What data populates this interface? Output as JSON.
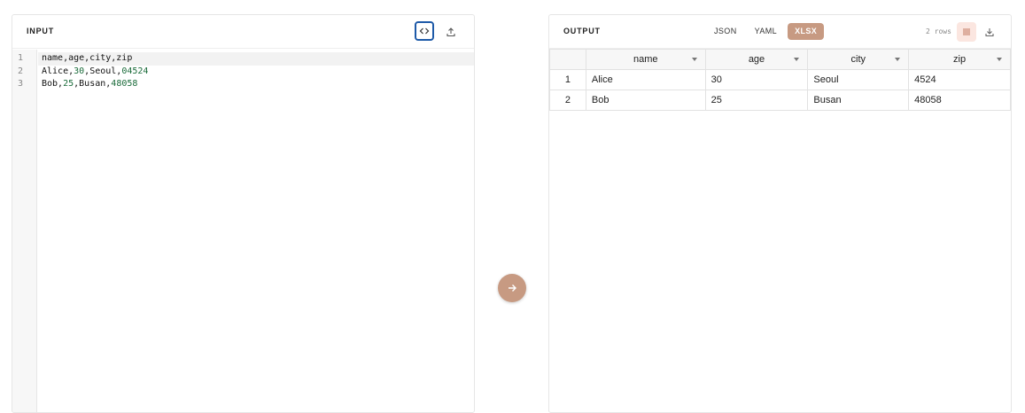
{
  "input": {
    "title": "INPUT",
    "line_numbers": [
      "1",
      "2",
      "3"
    ],
    "lines": [
      [
        {
          "t": "name,age,city,zip",
          "n": false
        }
      ],
      [
        {
          "t": "Alice,",
          "n": false
        },
        {
          "t": "30",
          "n": true
        },
        {
          "t": ",Seoul,",
          "n": false
        },
        {
          "t": "04524",
          "n": true
        }
      ],
      [
        {
          "t": "Bob,",
          "n": false
        },
        {
          "t": "25",
          "n": true
        },
        {
          "t": ",Busan,",
          "n": false
        },
        {
          "t": "48058",
          "n": true
        }
      ]
    ],
    "code_icon": "code-icon",
    "upload_icon": "upload-icon"
  },
  "convert": {
    "icon": "arrow-right-icon"
  },
  "output": {
    "title": "OUTPUT",
    "tabs": [
      {
        "label": "JSON",
        "active": false
      },
      {
        "label": "YAML",
        "active": false
      },
      {
        "label": "XLSX",
        "active": true
      }
    ],
    "row_count": "2 rows",
    "list_icon": "list-icon",
    "download_icon": "download-icon",
    "table": {
      "columns": [
        "name",
        "age",
        "city",
        "zip"
      ],
      "rows": [
        {
          "num": "1",
          "cells": [
            "Alice",
            "30",
            "Seoul",
            "4524"
          ]
        },
        {
          "num": "2",
          "cells": [
            "Bob",
            "25",
            "Busan",
            "48058"
          ]
        }
      ]
    }
  },
  "colors": {
    "accent": "#c79a82",
    "focus_border": "#1e5aa8",
    "number_text": "#1a6b3a"
  }
}
